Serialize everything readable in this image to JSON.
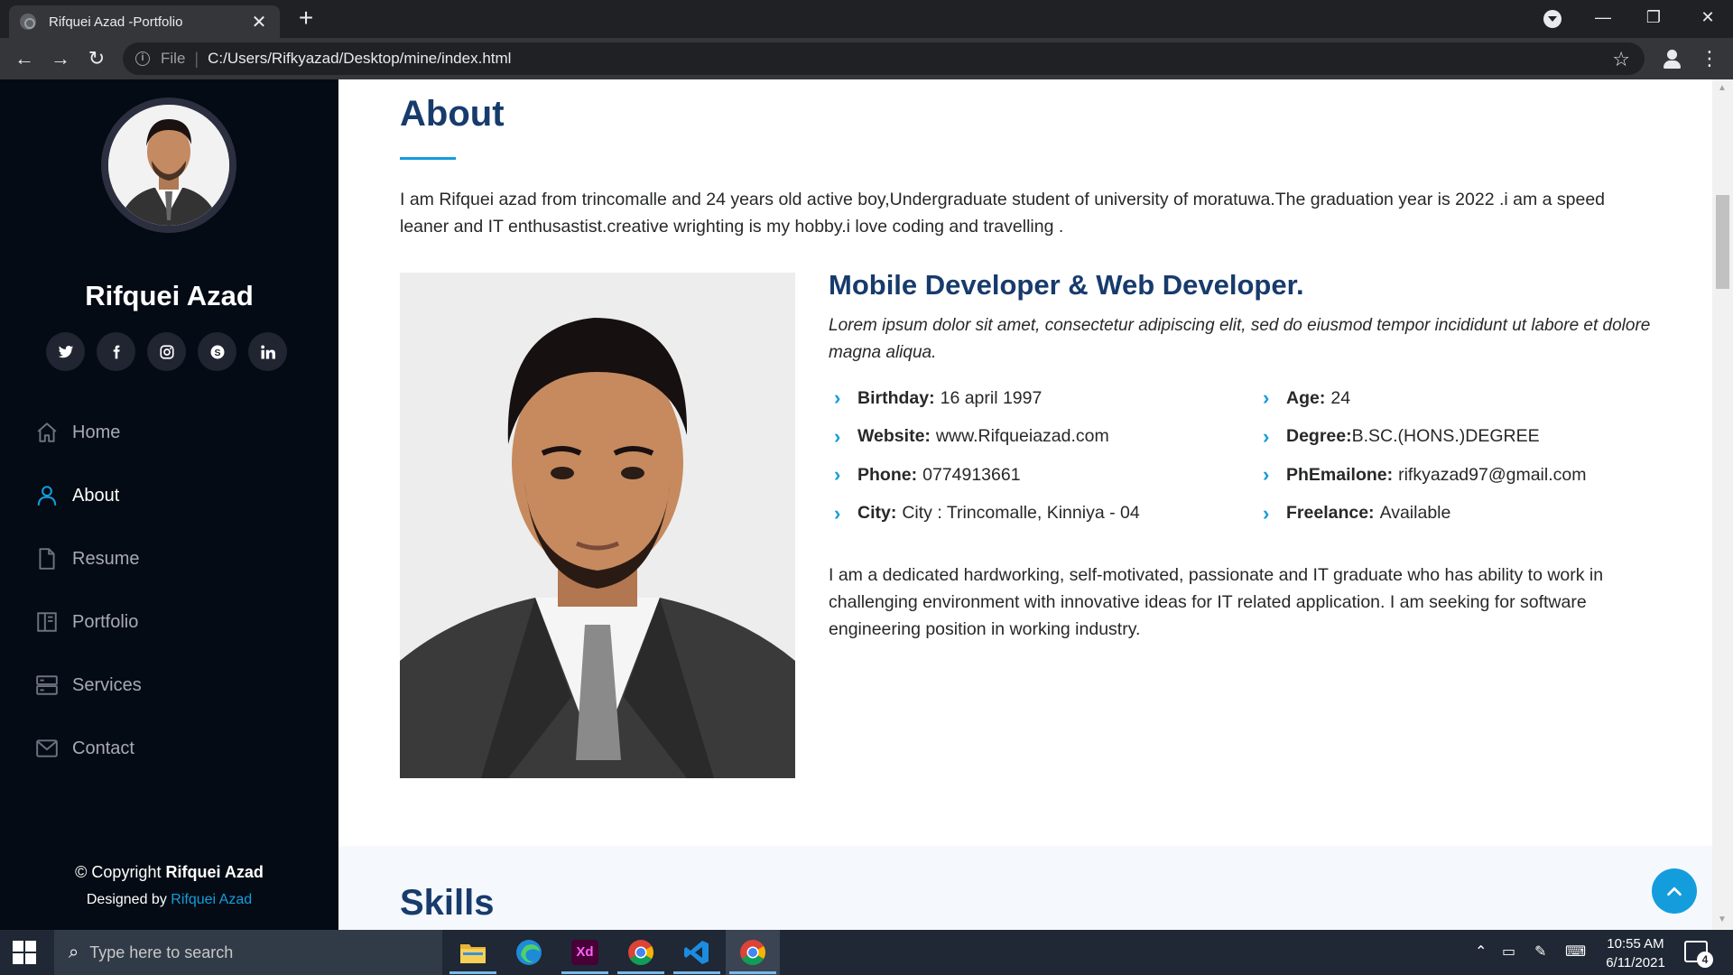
{
  "browser": {
    "tab_title": "Rifquei Azad -Portfolio",
    "url_scheme": "File",
    "url": "C:/Users/Rifkyazad/Desktop/mine/index.html"
  },
  "sidebar": {
    "name": "Rifquei Azad",
    "socials": [
      "twitter-icon",
      "facebook-icon",
      "instagram-icon",
      "skype-icon",
      "linkedin-icon"
    ],
    "nav": [
      {
        "label": "Home",
        "icon": "home-icon"
      },
      {
        "label": "About",
        "icon": "user-icon"
      },
      {
        "label": "Resume",
        "icon": "file-icon"
      },
      {
        "label": "Portfolio",
        "icon": "book-icon"
      },
      {
        "label": "Services",
        "icon": "server-icon"
      },
      {
        "label": "Contact",
        "icon": "envelope-icon"
      }
    ],
    "active_nav": "About",
    "copyright_prefix": "© Copyright",
    "copyright_name": "Rifquei Azad",
    "designed_prefix": "Designed by",
    "designed_link": "Rifquei Azad"
  },
  "about": {
    "title": "About",
    "intro": "I am Rifquei azad from trincomalle and 24 years old active boy,Undergraduate student of university of moratuwa.The graduation year is 2022 .i am a speed leaner and IT enthusastist.creative wrighting is my hobby.i love coding and travelling .",
    "role": "Mobile Developer & Web Developer.",
    "lorem": "Lorem ipsum dolor sit amet, consectetur adipiscing elit, sed do eiusmod tempor incididunt ut labore et dolore magna aliqua.",
    "facts": [
      {
        "label": "Birthday:",
        "value": "16 april 1997"
      },
      {
        "label": "Age:",
        "value": "24"
      },
      {
        "label": "Website:",
        "value": "www.Rifqueiazad.com"
      },
      {
        "label": "Degree:",
        "value": "B.SC.(HONS.)DEGREE"
      },
      {
        "label": "Phone:",
        "value": "0774913661"
      },
      {
        "label": "PhEmailone:",
        "value": "rifkyazad97@gmail.com"
      },
      {
        "label": "City:",
        "value": "City : Trincomalle, Kinniya - 04"
      },
      {
        "label": "Freelance:",
        "value": "Available"
      }
    ],
    "bio": "I am a dedicated hardworking, self-motivated, passionate and IT graduate who has ability to work in challenging environment with innovative ideas for IT related application. I am seeking for software engineering position in working industry."
  },
  "skills": {
    "title": "Skills"
  },
  "taskbar": {
    "search_placeholder": "Type here to search",
    "apps": [
      "file-explorer-icon",
      "edge-icon",
      "adobe-xd-icon",
      "chrome-icon",
      "vscode-icon",
      "chrome-icon"
    ],
    "xd_label": "Xd",
    "time": "10:55 AM",
    "date": "6/11/2021",
    "notification_count": "4"
  },
  "colors": {
    "accent": "#149ddd",
    "heading": "#173b6c",
    "sidebar_bg": "#040b14"
  }
}
